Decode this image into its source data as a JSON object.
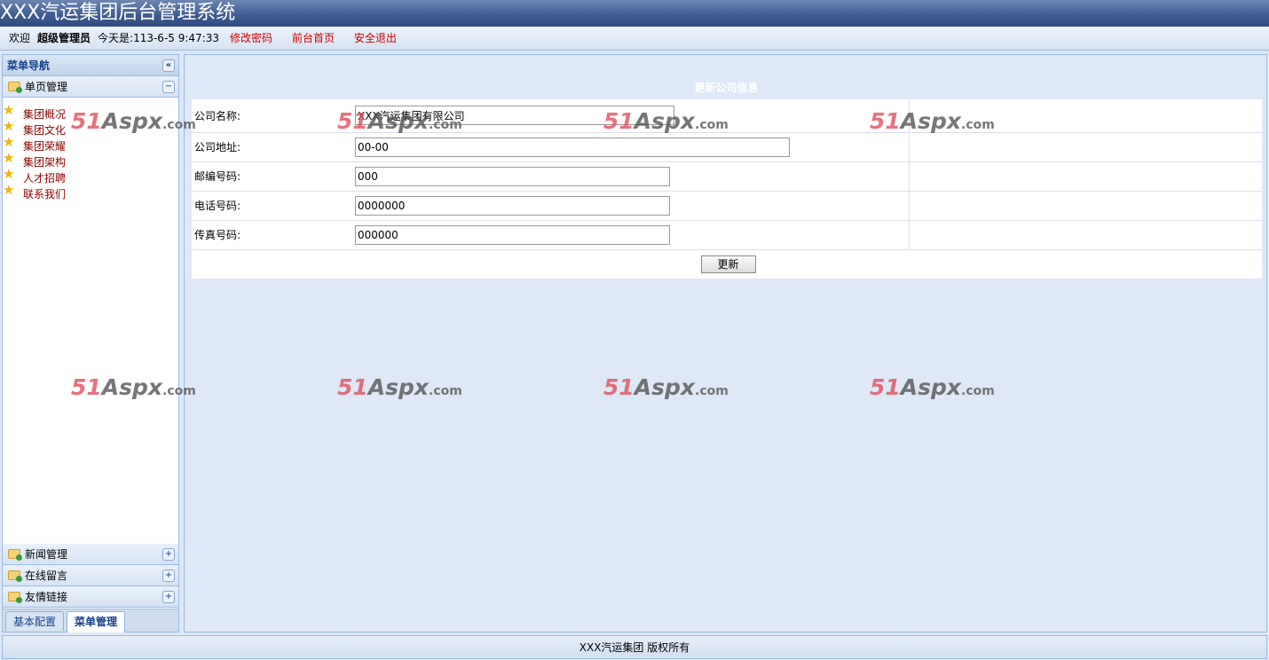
{
  "header": {
    "title": "XXX汽运集团后台管理系统"
  },
  "toolbar": {
    "welcome": "欢迎",
    "user": "超级管理员",
    "date": "今天是:113-6-5 9:47:33",
    "links": [
      "修改密码",
      "前台首页",
      "安全退出"
    ]
  },
  "sidebar": {
    "title": "菜单导航",
    "sections": [
      {
        "label": "单页管理",
        "items": [
          "集团概况",
          "集团文化",
          "集团荣耀",
          "集团架构",
          "人才招聘",
          "联系我们"
        ]
      },
      {
        "label": "新闻管理"
      },
      {
        "label": "在线留言"
      },
      {
        "label": "友情链接"
      }
    ],
    "tabs": [
      "基本配置",
      "菜单管理"
    ]
  },
  "form": {
    "title": "更新公司信息",
    "fields": [
      {
        "label": "公司名称:",
        "value": "XXX汽运集团有限公司"
      },
      {
        "label": "公司地址:",
        "value": "00-00"
      },
      {
        "label": "邮编号码:",
        "value": "000"
      },
      {
        "label": "电话号码:",
        "value": "0000000"
      },
      {
        "label": "传真号码:",
        "value": "000000"
      }
    ],
    "submit": "更新"
  },
  "footer": {
    "text": "XXX汽运集团 版权所有"
  },
  "watermark": "51Aspx.com"
}
